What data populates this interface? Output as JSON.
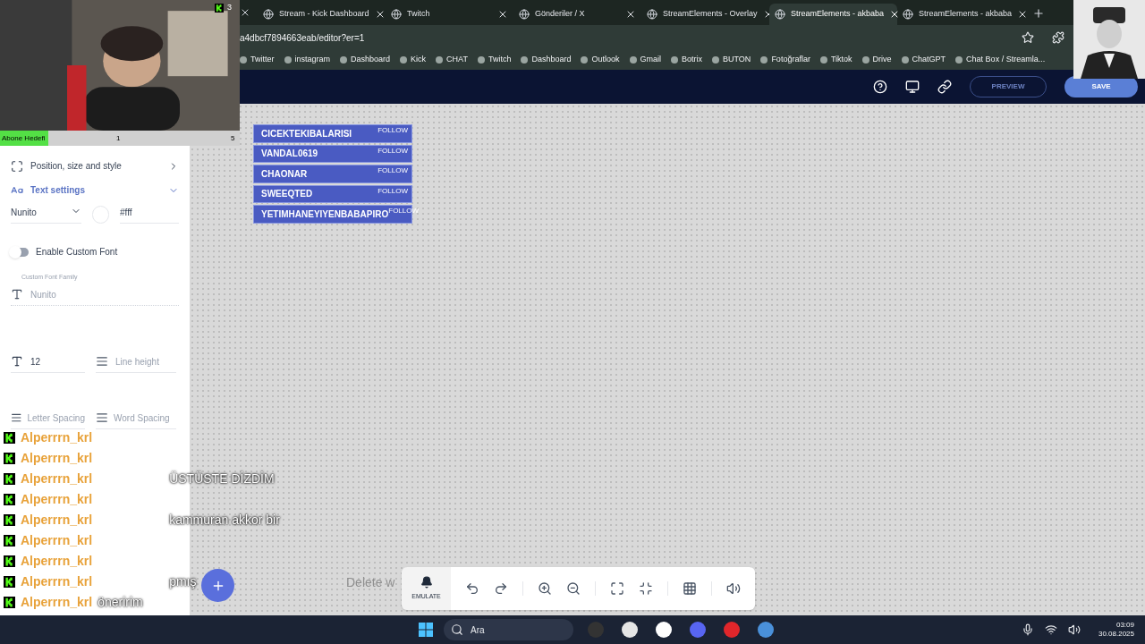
{
  "webcam": {
    "badge": "3"
  },
  "subscriber_goal": {
    "label": "Abone Hedefi",
    "current": "1",
    "target": "5",
    "level": 0.2
  },
  "tabs": [
    {
      "title": "Stream - Kick Dashboard",
      "selected": false
    },
    {
      "title": "Twitch",
      "selected": false
    },
    {
      "title": "Gönderiler / X",
      "selected": false
    },
    {
      "title": "StreamElements - Overlay",
      "selected": false
    },
    {
      "title": "StreamElements - akbaba",
      "selected": true
    },
    {
      "title": "StreamElements - akbaba",
      "selected": false
    }
  ],
  "address": "a4dbcf7894663eab/editor?er=1",
  "bookmarks": [
    "Twitter",
    "instagram",
    "Dashboard",
    "Kick",
    "CHAT",
    "Twitch",
    "Dashboard",
    "Outlook",
    "Gmail",
    "Botrix",
    "BUTON",
    "Fotoğraflar",
    "Tiktok",
    "Drive",
    "ChatGPT",
    "Chat Box / Streamla..."
  ],
  "header": {
    "preview": "PREVIEW",
    "save": "SAVE"
  },
  "panel": {
    "sections": [
      {
        "title": "Position, size and style",
        "expanded": false
      },
      {
        "title": "Text settings",
        "expanded": true
      }
    ],
    "font": "Nunito",
    "color": "#fff",
    "custom_font_toggle": {
      "label": "Enable Custom Font",
      "on": false
    },
    "custom_font_label": "Custom Font Family",
    "custom_font_placeholder": "Nunito",
    "size": "12",
    "line_height_placeholder": "Line height",
    "letter_spacing_placeholder": "Letter Spacing",
    "word_spacing_placeholder": "Word Spacing"
  },
  "follows": [
    {
      "name": "CICEKTEKIBALARISI",
      "label": "FOLLOW"
    },
    {
      "name": "VANDAL0619",
      "label": "FOLLOW"
    },
    {
      "name": "CHAONAR",
      "label": "FOLLOW"
    },
    {
      "name": "SWEEQTED",
      "label": "FOLLOW"
    },
    {
      "name": "YETIMHANEYIYENBABAPIRO",
      "label": "FOLLOW"
    }
  ],
  "chat": [
    {
      "user": "Alperrrn_krl"
    },
    {
      "user": "Alperrrn_krl"
    },
    {
      "user": "Alperrrn_krl",
      "message": "ÜSTÜSTE DİZDİM"
    },
    {
      "user": "Alperrrn_krl"
    },
    {
      "user": "Alperrrn_krl",
      "message": "kammuran akkor bir"
    },
    {
      "user": "Alperrrn_krl"
    },
    {
      "user": "Alperrrn_krl"
    },
    {
      "user": "Alperrrn_krl",
      "message": "pmış"
    },
    {
      "user": "Alperrrn_krl",
      "message": "öneririm"
    }
  ],
  "canvas_hint": "Delete w",
  "toolbar": {
    "emulate": "EMULATE"
  },
  "taskbar": {
    "search": "Ara",
    "time": "03:09",
    "date": "30.08.2025"
  }
}
